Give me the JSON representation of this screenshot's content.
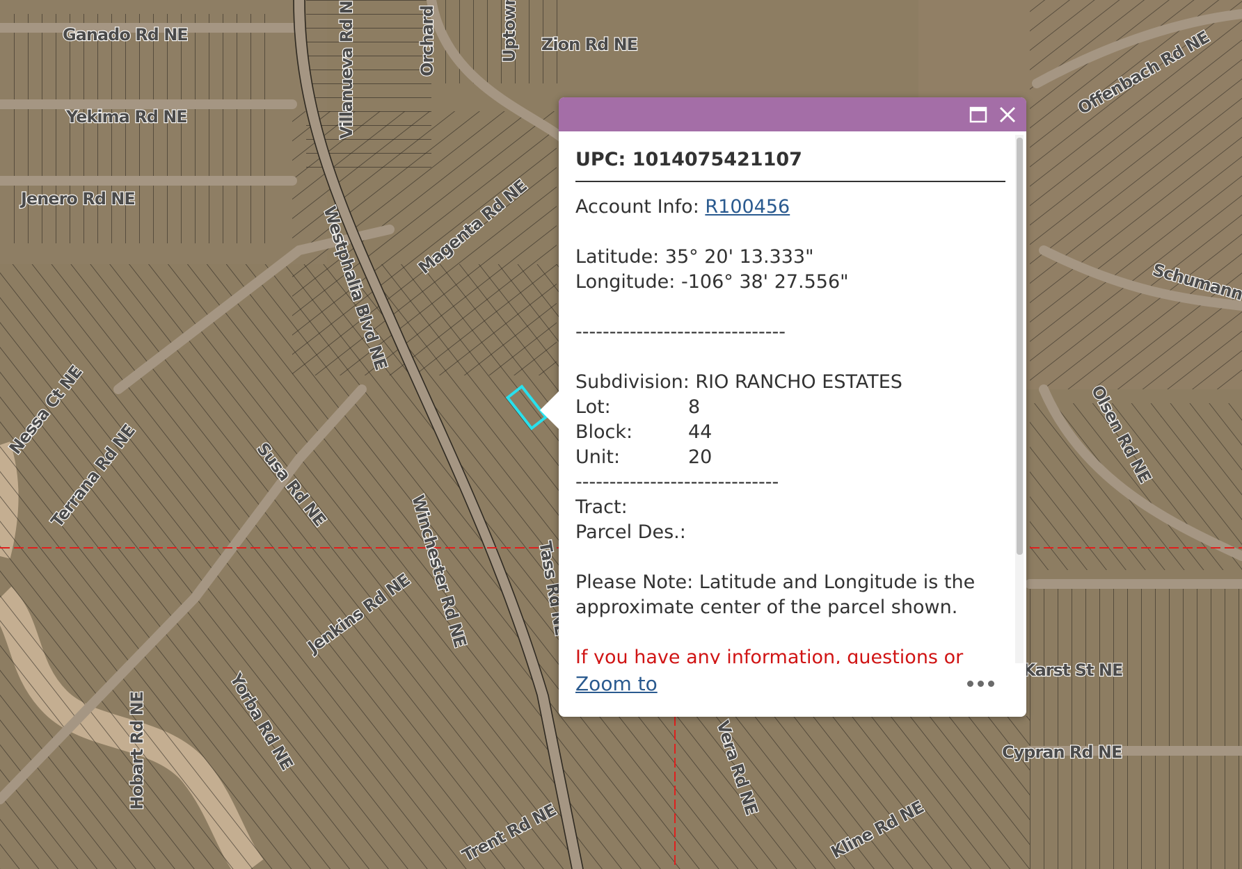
{
  "map": {
    "street_labels": [
      "Ganado Rd NE",
      "Yekima Rd NE",
      "Jenero Rd NE",
      "Westphalia Blvd NE",
      "Villanueva Rd NE",
      "Orchard",
      "Uptown",
      "Zion Rd NE",
      "Magenta Rd NE",
      "Nessa Ct NE",
      "Terrana Rd NE",
      "Susa Rd NE",
      "Jenkins Rd NE",
      "Winchester Rd NE",
      "Yorba Rd NE",
      "Hobart Rd NE",
      "Offenbach Rd NE",
      "Schumann",
      "Olsen Rd NE",
      "Karst St NE",
      "Cypran Rd NE",
      "Vera Rd NE",
      "Trent Rd NE",
      "Kline Rd NE",
      "Tass Rd NE"
    ],
    "colors": {
      "terrain": "#8d7d62",
      "parcel_line": "#2f2a22",
      "road": "#a59683",
      "wash": "#c4ae91",
      "selection": "#28e0ec",
      "grid_line": "#e0201e"
    }
  },
  "popup": {
    "colors": {
      "header": "#a46ea7",
      "link": "#2a5a8f",
      "note_red": "#d01414"
    },
    "header": {
      "maximize_icon": "maximize-icon",
      "close_icon": "close-icon"
    },
    "upc": "UPC: 1014075421107",
    "account_label": "Account Info: ",
    "account_link": "R100456",
    "latitude": "Latitude: 35° 20' 13.333\"",
    "longitude": "Longitude: -106° 38' 27.556\"",
    "separator": "-------------------------------",
    "subdivision": "Subdivision: RIO RANCHO ESTATES",
    "lot_label": "Lot:",
    "lot_value": "8",
    "block_label": "Block:",
    "block_value": "44",
    "unit_label": "Unit:",
    "unit_value": "20",
    "separator2": "------------------------------",
    "tract_label": "Tract:",
    "parcel_des_label": "Parcel Des.:",
    "note": "Please Note: Latitude and Longitude is the approximate center of the parcel shown.",
    "red_note": "If you have any information, questions or concerns about this parcel, please contact",
    "zoom_to": "Zoom to",
    "more_icon": "more-icon"
  }
}
